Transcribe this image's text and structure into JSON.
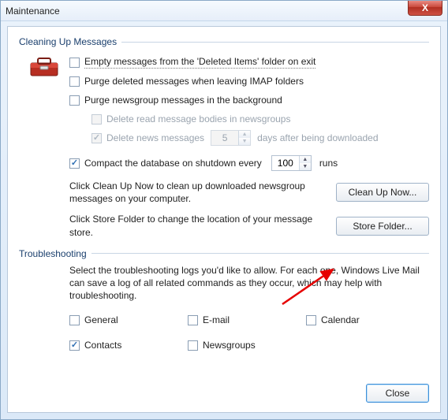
{
  "window": {
    "title": "Maintenance",
    "close_label": "X"
  },
  "cleaning": {
    "header": "Cleaning Up Messages",
    "empty_deleted": "Empty messages from the 'Deleted Items' folder on exit",
    "purge_imap": "Purge deleted messages when leaving IMAP folders",
    "purge_newsgroup": "Purge newsgroup messages in the background",
    "delete_read_bodies": "Delete read message bodies in newsgroups",
    "delete_news_msgs": "Delete news messages",
    "delete_news_days": "5",
    "delete_news_suffix": "days after being downloaded",
    "compact_label": "Compact the database on shutdown every",
    "compact_value": "100",
    "compact_suffix": "runs",
    "cleanup_desc": "Click Clean Up Now to clean up downloaded newsgroup messages on your computer.",
    "cleanup_btn": "Clean Up Now...",
    "store_desc": "Click Store Folder to change the location of your message store.",
    "store_btn": "Store Folder..."
  },
  "troubleshooting": {
    "header": "Troubleshooting",
    "desc": "Select the troubleshooting logs you'd like to allow. For each one, Windows Live Mail can save a log of all related commands as they occur, which may help with troubleshooting.",
    "general": "General",
    "email": "E-mail",
    "calendar": "Calendar",
    "contacts": "Contacts",
    "newsgroups": "Newsgroups"
  },
  "footer": {
    "close": "Close"
  }
}
